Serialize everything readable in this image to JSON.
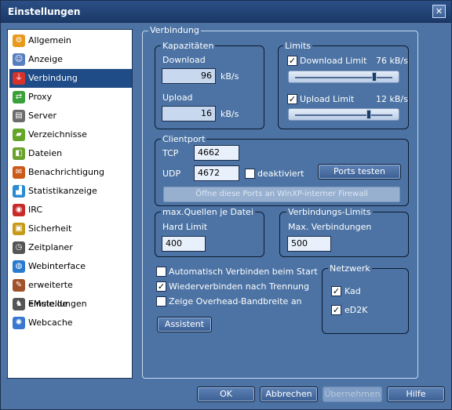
{
  "window": {
    "title": "Einstellungen",
    "close_glyph": "✕"
  },
  "sidebar": {
    "items": [
      {
        "label": "Allgemein",
        "icon": "gear-icon",
        "color": "#e89a1c",
        "glyph": "⚙",
        "selected": false
      },
      {
        "label": "Anzeige",
        "icon": "person-icon",
        "color": "#5a7fbf",
        "glyph": "☺",
        "selected": false
      },
      {
        "label": "Verbindung",
        "icon": "network-plug-icon",
        "color": "#d8322a",
        "glyph": "⏚",
        "selected": true
      },
      {
        "label": "Proxy",
        "icon": "proxy-icon",
        "color": "#3aa03a",
        "glyph": "⇄",
        "selected": false
      },
      {
        "label": "Server",
        "icon": "server-icon",
        "color": "#6c6c6c",
        "glyph": "▤",
        "selected": false
      },
      {
        "label": "Verzeichnisse",
        "icon": "folder-icon",
        "color": "#64a52a",
        "glyph": "▰",
        "selected": false
      },
      {
        "label": "Dateien",
        "icon": "files-icon",
        "color": "#6aa22e",
        "glyph": "◧",
        "selected": false
      },
      {
        "label": "Benachrichtigung",
        "icon": "notification-icon",
        "color": "#cc5a1a",
        "glyph": "✉",
        "selected": false
      },
      {
        "label": "Statistikanzeige",
        "icon": "statistics-icon",
        "color": "#2a8ad2",
        "glyph": "▟",
        "selected": false
      },
      {
        "label": "IRC",
        "icon": "irc-icon",
        "color": "#c82a2a",
        "glyph": "◉",
        "selected": false
      },
      {
        "label": "Sicherheit",
        "icon": "lock-icon",
        "color": "#c89a1a",
        "glyph": "▣",
        "selected": false
      },
      {
        "label": "Zeitplaner",
        "icon": "clock-icon",
        "color": "#555555",
        "glyph": "◷",
        "selected": false
      },
      {
        "label": "Webinterface",
        "icon": "globe-icon",
        "color": "#2a7ad0",
        "glyph": "◍",
        "selected": false
      },
      {
        "label": "erweiterte Einstellungen",
        "icon": "tools-icon",
        "color": "#a0522a",
        "glyph": "✎",
        "selected": false
      },
      {
        "label": "eMule.de",
        "icon": "emule-mule-icon",
        "color": "#555555",
        "glyph": "♞",
        "selected": false
      },
      {
        "label": "Webcache",
        "icon": "webcache-icon",
        "color": "#3a78d0",
        "glyph": "✺",
        "selected": false
      }
    ]
  },
  "main": {
    "frame_title": "Verbindung",
    "capacities": {
      "title": "Kapazitäten",
      "download_label": "Download",
      "download_value": "96",
      "download_unit": "kB/s",
      "upload_label": "Upload",
      "upload_value": "16",
      "upload_unit": "kB/s"
    },
    "limits": {
      "title": "Limits",
      "download_label": "Download Limit",
      "download_value": "76 kB/s",
      "download_checked": "✓",
      "download_slider_fraction": 0.79,
      "upload_label": "Upload Limit",
      "upload_value": "12 kB/s",
      "upload_checked": "✓",
      "upload_slider_fraction": 0.74
    },
    "clientport": {
      "title": "Clientport",
      "tcp_label": "TCP",
      "tcp_value": "4662",
      "udp_label": "UDP",
      "udp_value": "4672",
      "deactivated_label": "deaktiviert",
      "test_ports_label": "Ports testen",
      "firewall_label": "Öffne diese Ports an WinXP-interner Firewall"
    },
    "max_sources": {
      "title": "max.Quellen je Datei",
      "hard_limit_label": "Hard Limit",
      "hard_limit_value": "400"
    },
    "connection_limits": {
      "title": "Verbindungs-Limits",
      "max_connections_label": "Max. Verbindungen",
      "max_connections_value": "500"
    },
    "options": [
      {
        "label": "Automatisch Verbinden beim Start",
        "checked": ""
      },
      {
        "label": "Wiederverbinden nach Trennung",
        "checked": "✓"
      },
      {
        "label": "Zeige Overhead-Bandbreite an",
        "checked": ""
      }
    ],
    "network": {
      "title": "Netzwerk",
      "kad_label": "Kad",
      "kad_checked": "✓",
      "ed2k_label": "eD2K",
      "ed2k_checked": "✓"
    },
    "wizard_label": "Assistent"
  },
  "footer": {
    "ok_label": "OK",
    "cancel_label": "Abbrechen",
    "apply_label": "Übernehmen",
    "help_label": "Hilfe"
  }
}
